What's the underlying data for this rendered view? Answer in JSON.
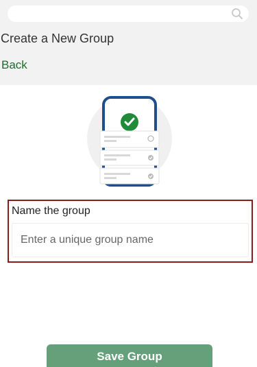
{
  "search": {
    "placeholder": "",
    "icon": "search-icon"
  },
  "header": {
    "title": "Create a New Group",
    "back_label": "Back"
  },
  "illustration": {
    "icon": "phone-checklist-illustration"
  },
  "form": {
    "label": "Name the group",
    "placeholder": "Enter a unique group name",
    "value": ""
  },
  "actions": {
    "save_label": "Save Group"
  },
  "colors": {
    "accent_green": "#1f6b2f",
    "button_green": "#65a07b",
    "focus_border": "#8b1a1a",
    "phone_frame": "#1f4e8c",
    "check_green": "#1e8a3a"
  }
}
